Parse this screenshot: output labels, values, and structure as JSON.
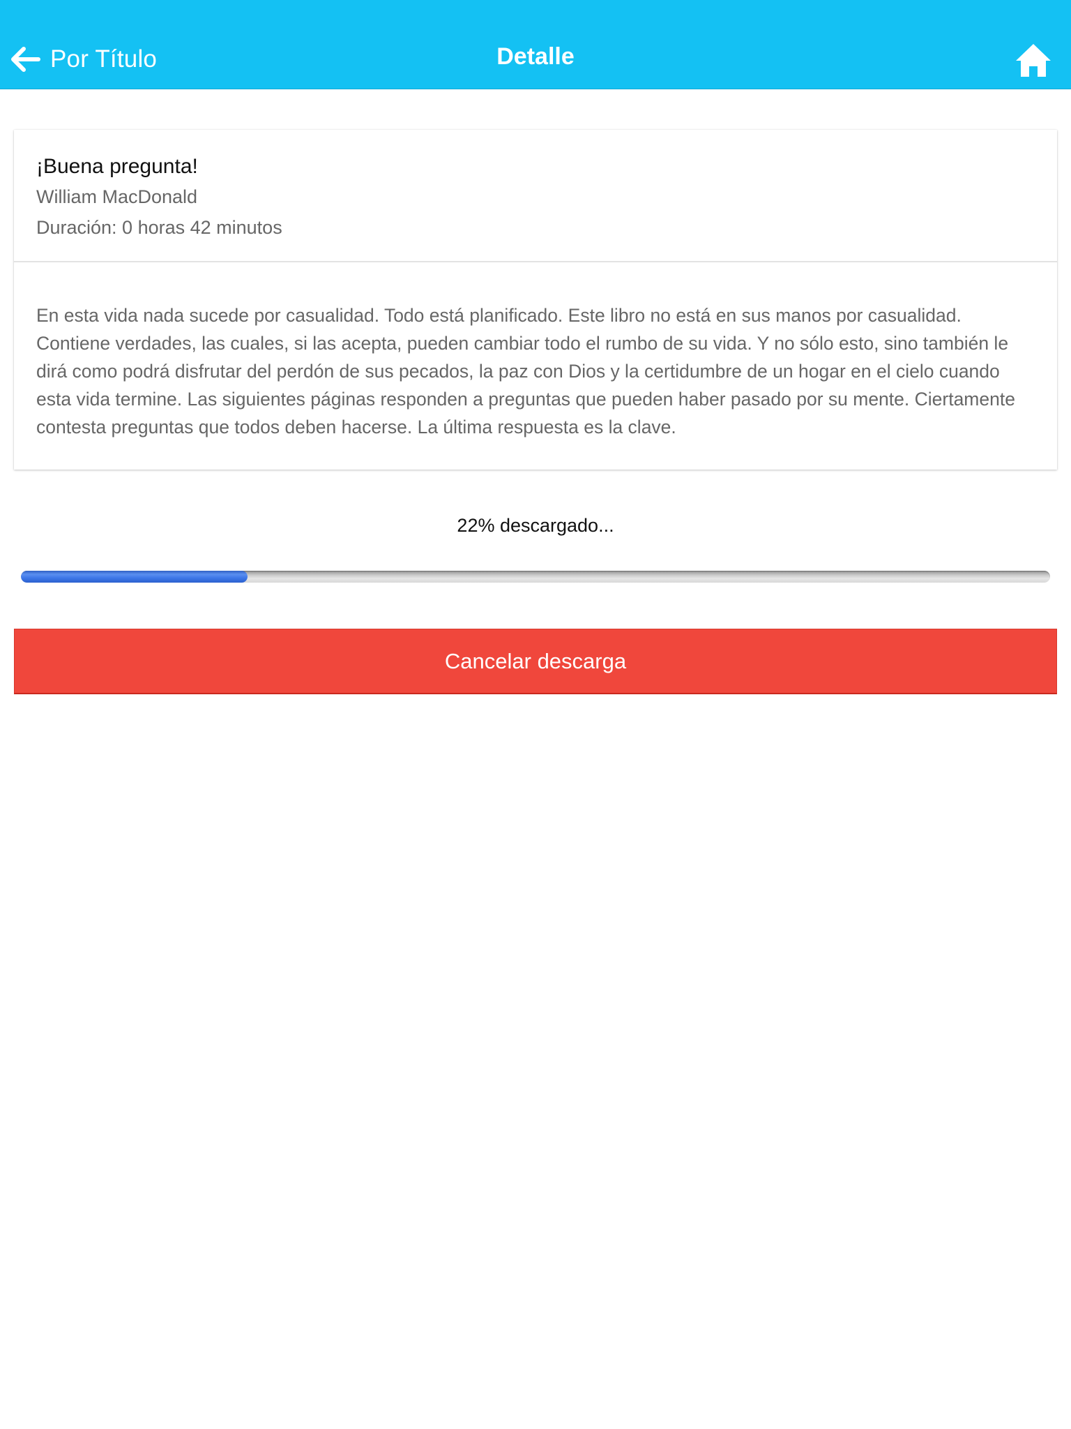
{
  "navbar": {
    "back_label": "Por Título",
    "title": "Detalle",
    "background_color": "#14c1f3",
    "back_icon": "arrow-left-icon",
    "home_icon": "home-icon"
  },
  "book": {
    "title": "¡Buena pregunta!",
    "author": "William MacDonald",
    "duration": "Duración: 0 horas 42 minutos",
    "description": "En esta vida nada sucede por casualidad. Todo está planificado. Este libro no está en sus manos por casualidad. Contiene verdades, las cuales, si las acepta, pueden cambiar todo el rumbo de su vida. Y no sólo esto, sino también le dirá como podrá disfrutar del perdón de sus pecados, la paz con Dios y la certidumbre de un hogar en el cielo cuando esta vida termine. Las siguientes páginas responden a preguntas que pueden haber pasado por su mente. Ciertamente contesta preguntas que todos deben hacerse. La última respuesta es la clave."
  },
  "download": {
    "status_text": "22% descargado...",
    "progress_percent": 22,
    "cancel_label": "Cancelar descarga",
    "cancel_color": "#f0473c"
  }
}
